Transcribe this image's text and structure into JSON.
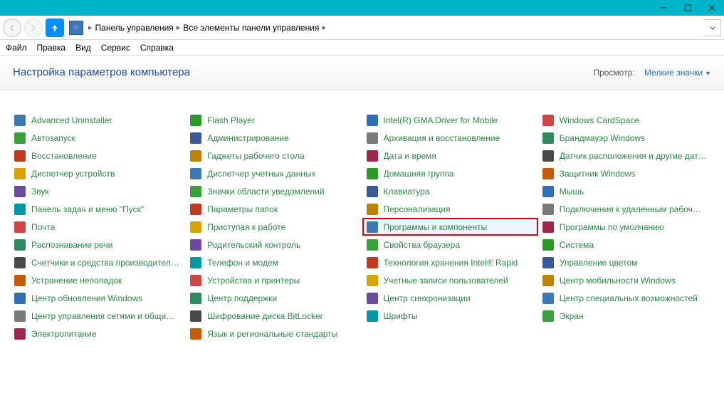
{
  "titlebar": {
    "minimize": "—",
    "maximize": "☐",
    "close": "✕"
  },
  "address": {
    "part1": "Панель управления",
    "part2": "Все элементы панели управления"
  },
  "menu": {
    "file": "Файл",
    "edit": "Правка",
    "view": "Вид",
    "service": "Сервис",
    "help": "Справка"
  },
  "heading": "Настройка параметров компьютера",
  "view_by_label": "Просмотр:",
  "view_by_value": "Мелкие значки",
  "highlighted": "Программы и компоненты",
  "columns": [
    [
      "Advanced Uninstaller",
      "Автозапуск",
      "Восстановление",
      "Диспетчер устройств",
      "Звук",
      "Панель задач и меню \"Пуск\"",
      "Почта",
      "Распознавание речи",
      "Счетчики и средства производител…",
      "Устранение неполадок",
      "Центр обновления Windows",
      "Центр управления сетями и общи…",
      "Электропитание"
    ],
    [
      "Flash Player",
      "Администрирование",
      "Гаджеты рабочего стола",
      "Диспетчер учетных данных",
      "Значки области уведомлений",
      "Параметры папок",
      "Приступая к работе",
      "Родительский контроль",
      "Телефон и модем",
      "Устройства и принтеры",
      "Центр поддержки",
      "Шифрование диска BitLocker",
      "Язык и региональные стандарты"
    ],
    [
      "Intel(R) GMA Driver for Mobile",
      "Архивация и восстановление",
      "Дата и время",
      "Домашняя группа",
      "Клавиатура",
      "Персонализация",
      "Программы и компоненты",
      "Свойства браузера",
      "Технология хранения Intel® Rapid",
      "Учетные записи пользователей",
      "Центр синхронизации",
      "Шрифты"
    ],
    [
      "Windows CardSpace",
      "Брандмауэр Windows",
      "Датчик расположения и другие дат…",
      "Защитник Windows",
      "Мышь",
      "Подключения к удаленным рабоч…",
      "Программы по умолчанию",
      "Система",
      "Управление цветом",
      "Центр мобильности Windows",
      "Центр специальных возможностей",
      "Экран"
    ]
  ]
}
